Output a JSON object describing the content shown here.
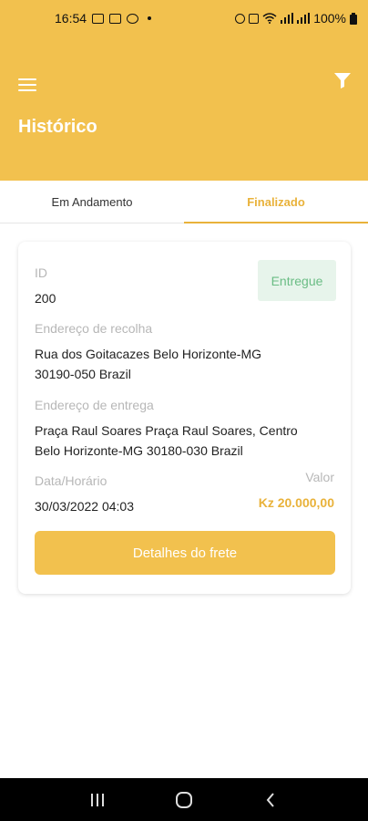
{
  "status_bar": {
    "time": "16:54",
    "battery": "100%"
  },
  "header": {
    "title": "Histórico"
  },
  "tabs": [
    {
      "label": "Em Andamento",
      "active": false
    },
    {
      "label": "Finalizado",
      "active": true
    }
  ],
  "card": {
    "id_label": "ID",
    "id_value": "200",
    "status_badge": "Entregue",
    "pickup_label": "Endereço de recolha",
    "pickup_line1": "Rua dos Goitacazes Belo Horizonte-MG",
    "pickup_line2": "30190-050 Brazil",
    "delivery_label": "Endereço de entrega",
    "delivery_line1": "Praça Raul Soares Praça Raul Soares, Centro",
    "delivery_line2": "Belo Horizonte-MG 30180-030 Brazil",
    "datetime_label": "Data/Horário",
    "datetime_value": "30/03/2022 04:03",
    "valor_label": "Valor",
    "valor_value": "Kz 20.000,00",
    "details_button": "Detalhes do frete"
  },
  "colors": {
    "accent": "#f2c14e",
    "accent_text": "#e9b23a",
    "badge_bg": "#e7f4eb",
    "badge_text": "#6bbd85"
  },
  "icons": {
    "menu": "menu-icon",
    "filter": "filter-icon",
    "nav_recents": "recents-icon",
    "nav_home": "home-icon",
    "nav_back": "back-icon"
  }
}
